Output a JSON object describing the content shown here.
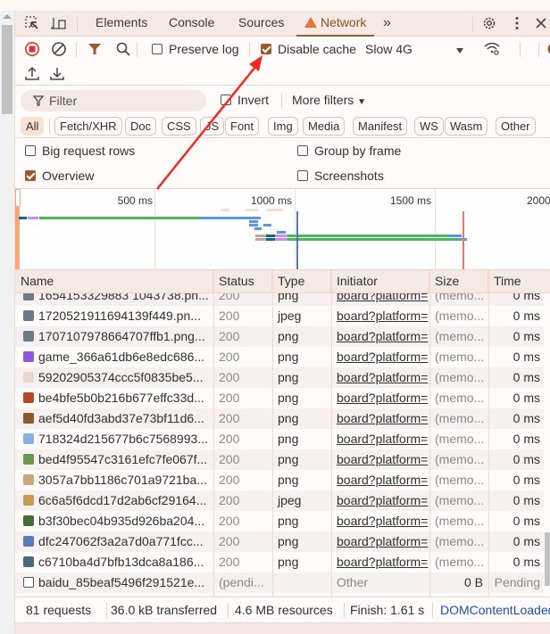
{
  "tabs": {
    "items": [
      {
        "label": "Elements",
        "active": false
      },
      {
        "label": "Console",
        "active": false
      },
      {
        "label": "Sources",
        "active": false
      },
      {
        "label": "Network",
        "active": true,
        "icon": "warning-icon"
      }
    ],
    "more_label": "»"
  },
  "toolbar": {
    "preserve_log_label": "Preserve log",
    "preserve_log_checked": false,
    "disable_cache_label": "Disable cache",
    "disable_cache_checked": true,
    "throttling_value": "Slow 4G"
  },
  "filter": {
    "placeholder": "Filter",
    "invert_label": "Invert",
    "invert_checked": false,
    "more_filters_label": "More filters"
  },
  "type_filters": [
    "All",
    "Fetch/XHR",
    "Doc",
    "CSS",
    "JS",
    "Font",
    "Img",
    "Media",
    "Manifest",
    "WS",
    "Wasm",
    "Other"
  ],
  "type_filter_active": "All",
  "options": {
    "big_request_rows": {
      "label": "Big request rows",
      "checked": false
    },
    "group_by_frame": {
      "label": "Group by frame",
      "checked": false
    },
    "overview": {
      "label": "Overview",
      "checked": true
    },
    "screenshots": {
      "label": "Screenshots",
      "checked": false
    }
  },
  "overview": {
    "ticks": [
      "500 ms",
      "1000 ms",
      "1500 ms",
      "2000"
    ],
    "colors": {
      "waiting": "#0f6b80",
      "connecting": "#c58ef0",
      "download": "#4cb55e",
      "blue": "#5a96e8",
      "dom_content_loaded": "#2f5fb4",
      "load": "#e05c4a"
    }
  },
  "table": {
    "columns": [
      "Name",
      "Status",
      "Type",
      "Initiator",
      "Size",
      "Time"
    ],
    "rows": [
      {
        "name": "1654153329883 1043738.pn...",
        "status": "200",
        "type": "png",
        "initiator": "board?platform=",
        "size": "(memo...",
        "time": "0 ms",
        "icon_color": "#6a7a88"
      },
      {
        "name": "1720521911694139f449.pn...",
        "status": "200",
        "type": "jpeg",
        "initiator": "board?platform=",
        "size": "(memo...",
        "time": "0 ms",
        "icon_color": "#6a7a88"
      },
      {
        "name": "1707107978664707ffb1.png...",
        "status": "200",
        "type": "png",
        "initiator": "board?platform=",
        "size": "(memo...",
        "time": "0 ms",
        "icon_color": "#6a7a88"
      },
      {
        "name": "game_366a61db6e8edc686...",
        "status": "200",
        "type": "png",
        "initiator": "board?platform=",
        "size": "(memo...",
        "time": "0 ms",
        "icon_color": "#8a5ad8"
      },
      {
        "name": "59202905374ccc5f0835be5...",
        "status": "200",
        "type": "png",
        "initiator": "board?platform=",
        "size": "(memo...",
        "time": "0 ms",
        "icon_color": "#e8d8c8"
      },
      {
        "name": "be4bfe5b0b216b677effc33d...",
        "status": "200",
        "type": "png",
        "initiator": "board?platform=",
        "size": "(memo...",
        "time": "0 ms",
        "icon_color": "#b84a2a"
      },
      {
        "name": "aef5d40fd3abd37e73bf11d6...",
        "status": "200",
        "type": "png",
        "initiator": "board?platform=",
        "size": "(memo...",
        "time": "0 ms",
        "icon_color": "#8a5a2a"
      },
      {
        "name": "718324d215677b6c7568993...",
        "status": "200",
        "type": "png",
        "initiator": "board?platform=",
        "size": "(memo...",
        "time": "0 ms",
        "icon_color": "#8ab0e8"
      },
      {
        "name": "bed4f95547c3161efc7fe067f...",
        "status": "200",
        "type": "png",
        "initiator": "board?platform=",
        "size": "(memo...",
        "time": "0 ms",
        "icon_color": "#6a9a4a"
      },
      {
        "name": "3057a7bb1186c701a9721ba...",
        "status": "200",
        "type": "png",
        "initiator": "board?platform=",
        "size": "(memo...",
        "time": "0 ms",
        "icon_color": "#c8a878"
      },
      {
        "name": "6c6a5f6dcd17d2ab6cf29164...",
        "status": "200",
        "type": "jpeg",
        "initiator": "board?platform=",
        "size": "(memo...",
        "time": "0 ms",
        "icon_color": "#c89a5a"
      },
      {
        "name": "b3f30bec04b935d926ba204...",
        "status": "200",
        "type": "png",
        "initiator": "board?platform=",
        "size": "(memo...",
        "time": "0 ms",
        "icon_color": "#4a6a3a"
      },
      {
        "name": "dfc247062f3a2a7d0a771fcc...",
        "status": "200",
        "type": "png",
        "initiator": "board?platform=",
        "size": "(memo...",
        "time": "0 ms",
        "icon_color": "#5a7ab8"
      },
      {
        "name": "c6710ba4d7bfb13dca8a186...",
        "status": "200",
        "type": "png",
        "initiator": "board?platform=",
        "size": "(memo...",
        "time": "0 ms",
        "icon_color": "#4a6a7a"
      },
      {
        "name": "baidu_85beaf5496f291521e...",
        "status": "(pendi...",
        "type": "",
        "initiator": "Other",
        "size": "0 B",
        "time": "Pending",
        "icon_color": "",
        "pending": true
      }
    ]
  },
  "summary": {
    "requests": "81 requests",
    "transferred": "36.0 kB transferred",
    "resources": "4.6 MB resources",
    "finish": "Finish: 1.61 s",
    "dom_content_loaded": "DOMContentLoaded"
  }
}
